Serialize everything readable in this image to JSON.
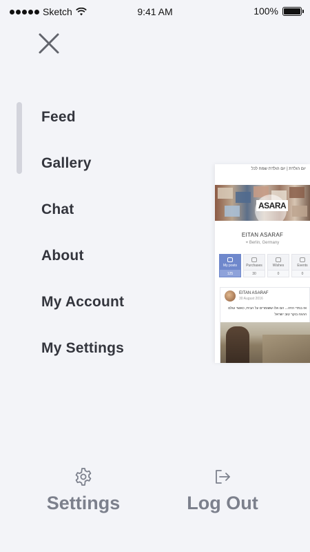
{
  "status_bar": {
    "carrier": "Sketch",
    "time": "9:41 AM",
    "battery": "100%"
  },
  "menu": {
    "items": [
      {
        "label": "Feed"
      },
      {
        "label": "Gallery"
      },
      {
        "label": "Chat"
      },
      {
        "label": "About"
      },
      {
        "label": "My Account"
      },
      {
        "label": "My Settings"
      }
    ]
  },
  "preview": {
    "header_text": "יום הולדת | יום הולדת שמח לכל",
    "brand": "ASARA",
    "profile_name": "EITAN ASARAF",
    "location": "Berlin, Germany",
    "stats": [
      {
        "label": "My posts",
        "count": "125"
      },
      {
        "label": "Purchases",
        "count": "30"
      },
      {
        "label": "Wishes",
        "count": "0"
      },
      {
        "label": "Events",
        "count": "0"
      }
    ],
    "post": {
      "author": "EITAN ASARAF",
      "date": "30 August 2016",
      "text_line1": "אז במדי הזיה... הם אלו ששומרים על הבית, כאשר עולם",
      "text_line2": "ההגה בוקר טוב ישראל"
    }
  },
  "bottom": {
    "settings_label": "Settings",
    "logout_label": "Log Out"
  },
  "colors": {
    "background": "#f3f4f8",
    "menu_text": "#33353d",
    "bottom_text": "#7c808c",
    "accent": "#6f88cc"
  }
}
